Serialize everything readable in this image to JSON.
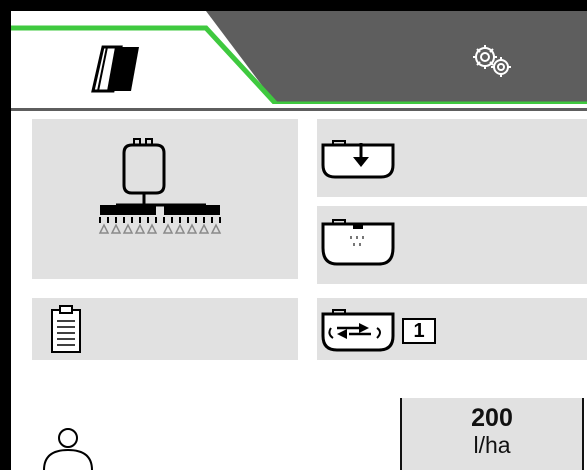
{
  "tabs": [
    {
      "id": "field",
      "icon": "field-tracks-icon",
      "active": true
    },
    {
      "id": "settings",
      "icon": "gears-icon",
      "active": false
    }
  ],
  "colors": {
    "accent": "#3fc93f",
    "tab_inactive": "#5e5e5e",
    "button_bg": "#e1e1e1"
  },
  "tiles": [
    {
      "id": "sprayer",
      "icon": "sprayer-boom-icon"
    },
    {
      "id": "tank-fill",
      "icon": "tank-fill-icon"
    },
    {
      "id": "tank-spray",
      "icon": "tank-spray-icon"
    },
    {
      "id": "documentation",
      "icon": "clipboard-icon"
    },
    {
      "id": "circulation",
      "icon": "tank-circulation-icon"
    }
  ],
  "circulation_step": "1",
  "application_rate": {
    "value": "200",
    "unit": "l/ha"
  },
  "profile": {
    "icon": "user-icon"
  }
}
